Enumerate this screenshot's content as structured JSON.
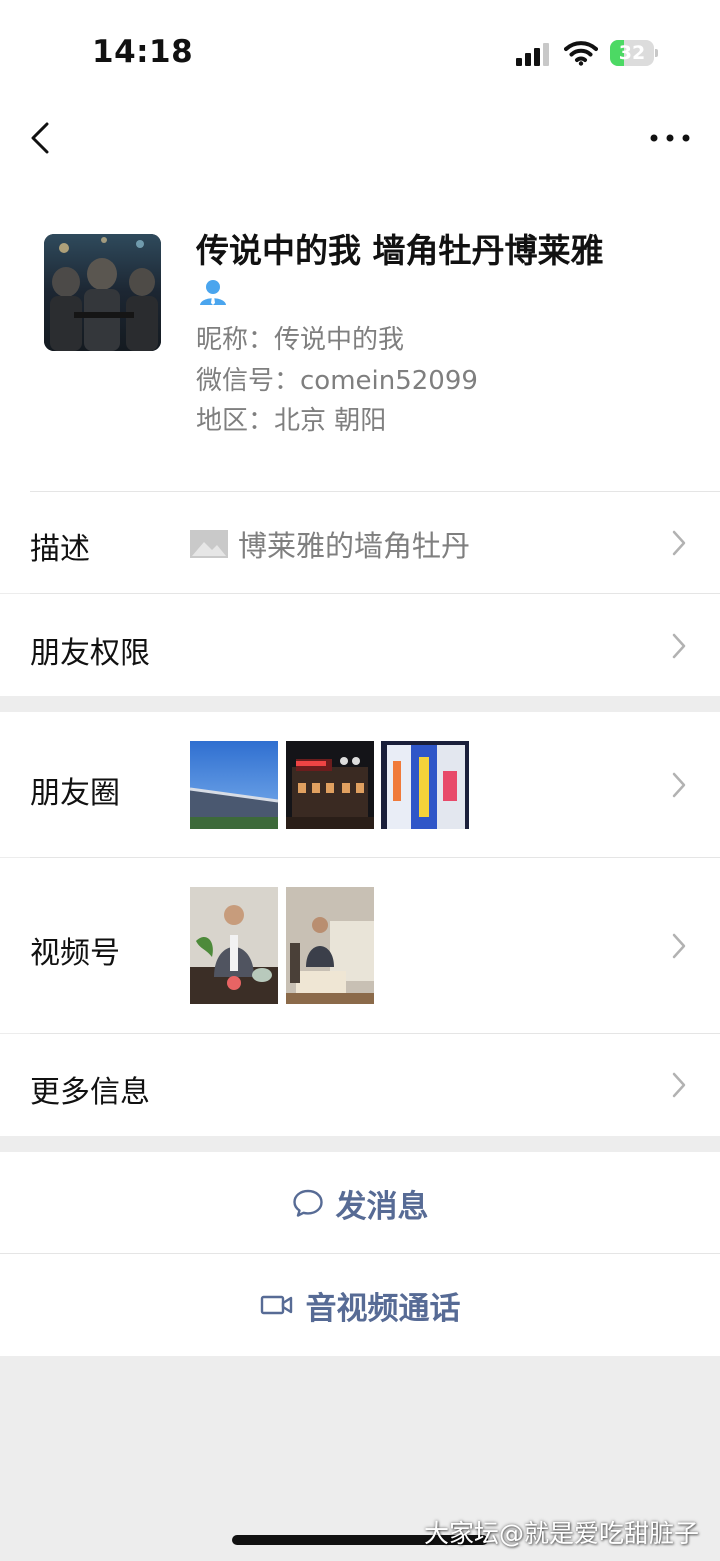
{
  "status_bar": {
    "time": "14:18",
    "battery": "32",
    "battery_level": 0.32
  },
  "profile": {
    "display_name": "传说中的我 墙角牡丹博莱雅",
    "nickname_line": "昵称：传说中的我",
    "wechat_id_line": "微信号：comein52099",
    "region_line": "地区：北京 朝阳"
  },
  "rows": {
    "description": {
      "label": "描述",
      "value": "博莱雅的墙角牡丹"
    },
    "friend_permissions": {
      "label": "朋友权限"
    },
    "moments": {
      "label": "朋友圈"
    },
    "channels": {
      "label": "视频号"
    },
    "more_info": {
      "label": "更多信息"
    }
  },
  "actions": {
    "send_message": "发消息",
    "av_call": "音视频通话"
  },
  "icons": [
    "back-icon",
    "more-icon",
    "person-icon",
    "image-placeholder-icon",
    "chevron-right-icon",
    "chat-bubble-icon",
    "video-camera-icon"
  ],
  "colors": {
    "accent": "#576b95",
    "secondary_text": "#7f7f7f",
    "battery_green": "#4cd964"
  },
  "watermark": "大家坛@就是爱吃甜脏子"
}
